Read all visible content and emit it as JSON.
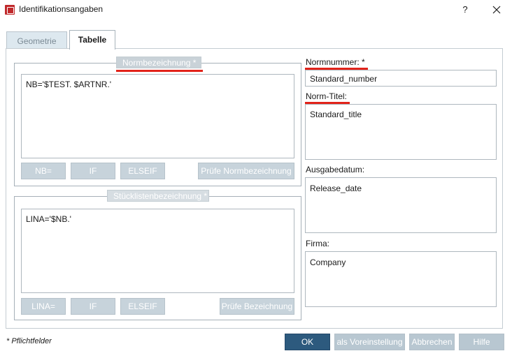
{
  "window": {
    "title": "Identifikationsangaben",
    "help_label": "?"
  },
  "tabs": [
    {
      "label": "Geometrie",
      "active": false
    },
    {
      "label": "Tabelle",
      "active": true
    }
  ],
  "normbezeichnung": {
    "legend": "Normbezeichnung *",
    "value": "NB='$TEST. $ARTNR.'",
    "buttons": {
      "nb": "NB=",
      "if": "IF",
      "elseif": "ELSEIF",
      "check": "Prüfe Normbezeichnung"
    }
  },
  "stueckliste": {
    "legend": "Stücklistenbezeichnung *",
    "value": "LINA='$NB.'",
    "buttons": {
      "lina": "LINA=",
      "if": "IF",
      "elseif": "ELSEIF",
      "check": "Prüfe Bezeichnung"
    }
  },
  "fields": {
    "normnummer": {
      "label": "Normnummer: *",
      "value": "Standard_number"
    },
    "norm_titel": {
      "label": "Norm-Titel:",
      "value": "Standard_title"
    },
    "ausgabedatum": {
      "label": "Ausgabedatum:",
      "value": "Release_date"
    },
    "firma": {
      "label": "Firma:",
      "value": "Company"
    }
  },
  "footer": {
    "required_note": "* Pflichtfelder",
    "ok": "OK",
    "default": "als Voreinstellung",
    "cancel": "Abbrechen",
    "help": "Hilfe"
  },
  "colors": {
    "highlight": "#e2231a",
    "primary_button": "#2d5a7e"
  }
}
